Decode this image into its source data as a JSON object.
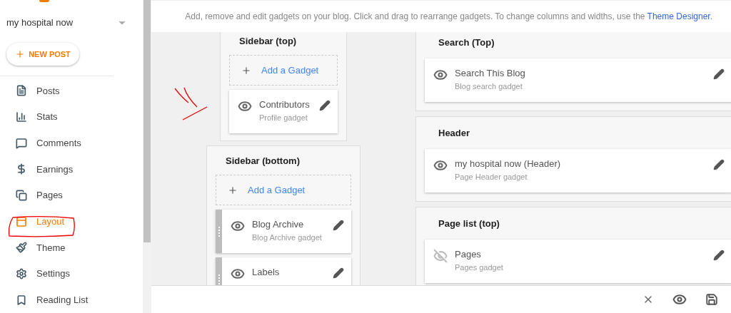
{
  "blog_selector": {
    "name": "my hospital now"
  },
  "new_post": {
    "label": "NEW POST"
  },
  "nav": [
    {
      "label": "Posts",
      "selected": false
    },
    {
      "label": "Stats",
      "selected": false
    },
    {
      "label": "Comments",
      "selected": false
    },
    {
      "label": "Earnings",
      "selected": false
    },
    {
      "label": "Pages",
      "selected": false
    },
    {
      "label": "Layout",
      "selected": true
    },
    {
      "label": "Theme",
      "selected": false
    },
    {
      "label": "Settings",
      "selected": false
    },
    {
      "label": "Reading List",
      "selected": false
    }
  ],
  "notice": {
    "text": "Add, remove and edit gadgets on your blog. Click and drag to rearrange gadgets. To change columns and widths, use the",
    "link": "Theme Designer",
    "end": "."
  },
  "left_sections": [
    {
      "title": "Sidebar (top)",
      "add_label": "Add a Gadget",
      "gadgets": [
        {
          "name": "Contributors",
          "type": "Profile gadget",
          "visible": true,
          "draggable": false
        }
      ]
    },
    {
      "title": "Sidebar (bottom)",
      "add_label": "Add a Gadget",
      "gadgets": [
        {
          "name": "Blog Archive",
          "type": "Blog Archive gadget",
          "visible": true,
          "draggable": true
        },
        {
          "name": "Labels",
          "visible": true,
          "draggable": true
        }
      ]
    }
  ],
  "right_sections": [
    {
      "title": "Search (Top)",
      "gadgets": [
        {
          "name": "Search This Blog",
          "type": "Blog search gadget",
          "visible": true,
          "draggable": false
        }
      ]
    },
    {
      "title": "Header",
      "gadgets": [
        {
          "name": "my hospital now (Header)",
          "type": "Page Header gadget",
          "visible": true,
          "draggable": false
        }
      ]
    },
    {
      "title": "Page list (top)",
      "gadgets": [
        {
          "name": "Pages",
          "type": "Pages gadget",
          "visible": false,
          "draggable": false
        }
      ]
    }
  ]
}
